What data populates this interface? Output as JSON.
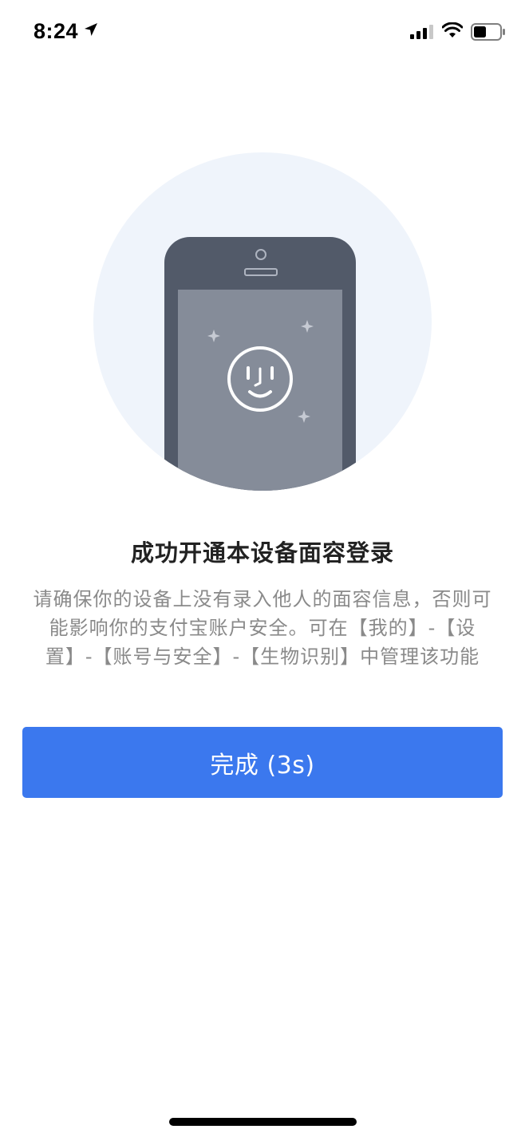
{
  "status_bar": {
    "time": "8:24",
    "icons": [
      "location-arrow-icon",
      "cellular-signal-icon",
      "wifi-icon",
      "battery-icon"
    ]
  },
  "illustration": {
    "icon": "face-id-phone-illustration"
  },
  "main": {
    "title": "成功开通本设备面容登录",
    "description": "请确保你的设备上没有录入他人的面容信息，否则可能影响你的支付宝账户安全。可在【我的】-【设置】-【账号与安全】-【生物识别】中管理该功能",
    "done_button_label": "完成 (3s)"
  },
  "colors": {
    "accent": "#3b78ee",
    "circle_bg": "#eff4fb",
    "phone_body": "#525a69",
    "phone_screen": "#858c99",
    "title_text": "#222222",
    "description_text": "#8a8a8a"
  }
}
